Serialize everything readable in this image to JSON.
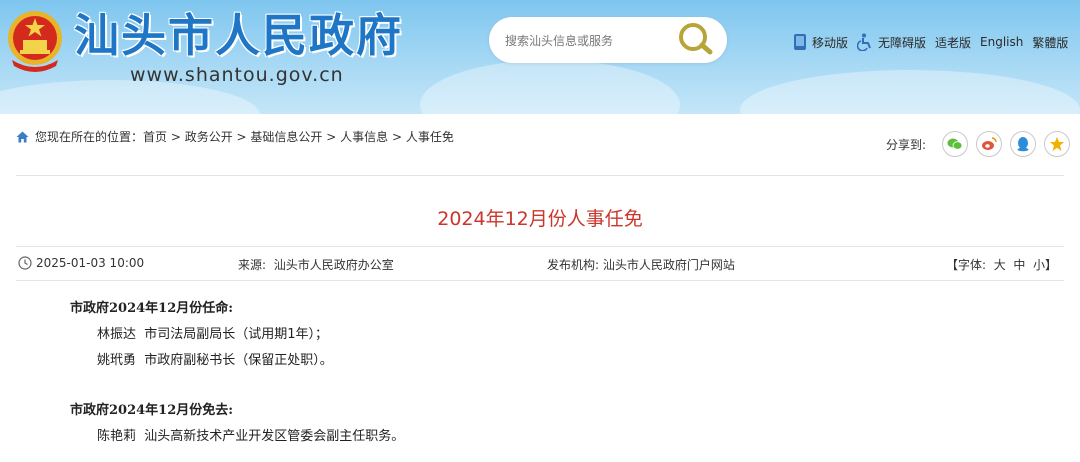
{
  "header": {
    "site_title": "汕头市人民政府",
    "site_url": "www.shantou.gov.cn",
    "search_placeholder": "搜索汕头信息或服务",
    "links": [
      {
        "label": "移动版",
        "icon": "mobile-icon"
      },
      {
        "label": "无障碍版",
        "icon": "accessibility-icon"
      },
      {
        "label": "适老版",
        "icon": ""
      },
      {
        "label": "English",
        "icon": ""
      },
      {
        "label": "繁體版",
        "icon": ""
      }
    ]
  },
  "breadcrumb": {
    "prefix": "您现在所在的位置：",
    "items": [
      "首页",
      "政务公开",
      "基础信息公开",
      "人事信息",
      "人事任免"
    ],
    "separator": " > "
  },
  "share": {
    "label": "分享到:",
    "targets": [
      {
        "name": "wechat",
        "color": "#5cbf3a"
      },
      {
        "name": "weibo",
        "color": "#e0563b"
      },
      {
        "name": "qq",
        "color": "#2d8ddb"
      },
      {
        "name": "qzone",
        "color": "#f0b100"
      }
    ]
  },
  "article": {
    "title": "2024年12月份人事任免",
    "date": "2025-01-03 10:00",
    "source_label": "来源:",
    "source": "汕头市人民政府办公室",
    "publisher_label": "发布机构:",
    "publisher": "汕头市人民政府门户网站",
    "font_label": "【字体:",
    "font_sizes": [
      "大",
      "中",
      "小"
    ],
    "font_close": "】",
    "sections": [
      {
        "heading": "市政府2024年12月份任命:",
        "lines": [
          "林振达  市司法局副局长（试用期1年）；",
          "姚玳勇  市政府副秘书长（保留正处职）。"
        ]
      },
      {
        "heading": "市政府2024年12月份免去:",
        "lines": [
          "陈艳莉  汕头高新技术产业开发区管委会副主任职务。"
        ]
      }
    ]
  }
}
